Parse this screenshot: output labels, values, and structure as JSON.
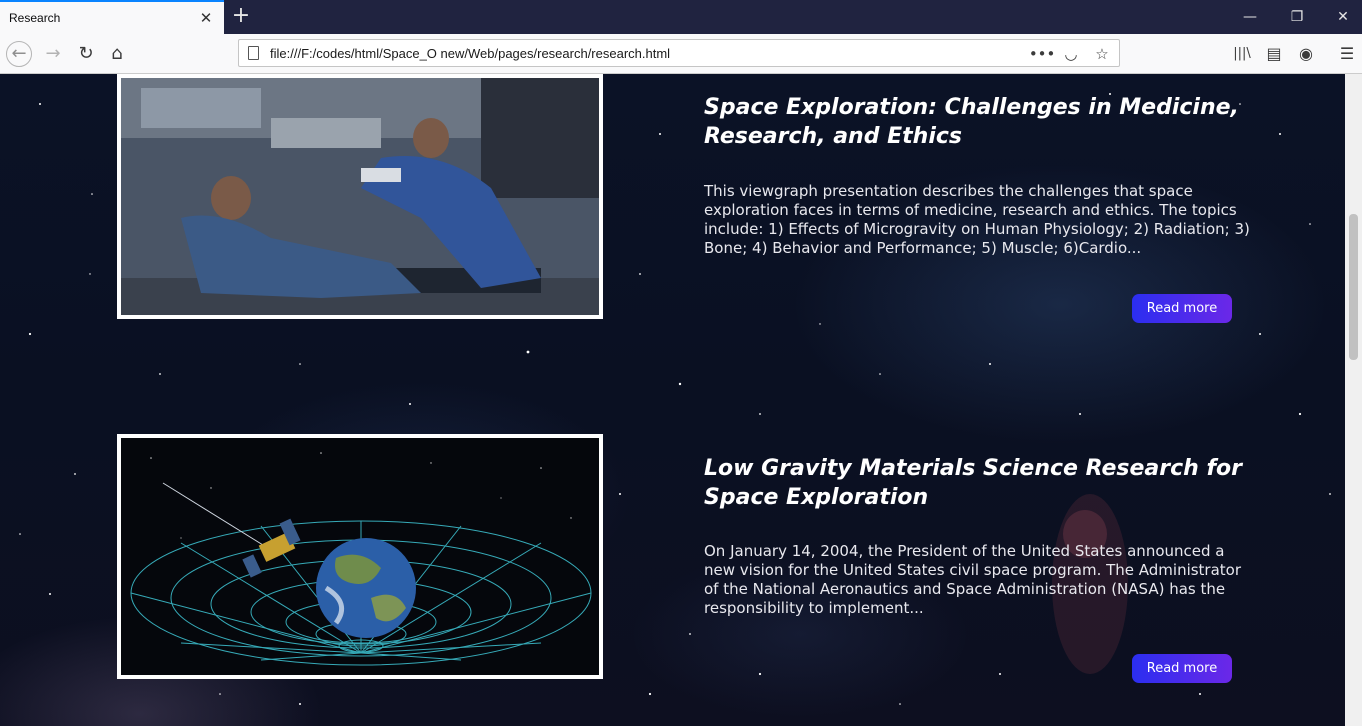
{
  "browser": {
    "tab_title": "Research",
    "url": "file:///F:/codes/html/Space_O new/Web/pages/research/research.html",
    "tab_close_glyph": "✕",
    "new_tab_glyph": "+",
    "icons": {
      "back": "←",
      "forward": "→",
      "reload": "↻",
      "home": "⌂",
      "page_actions": "•••",
      "pocket": "◡",
      "bookmark": "☆",
      "library": "|||\\",
      "sidebar": "▤",
      "account": "◉",
      "menu": "☰",
      "minimize": "—",
      "restore": "❐",
      "close": "✕"
    }
  },
  "articles": [
    {
      "title": "Space Exploration: Challenges in Medicine, Research, and Ethics",
      "description": "This viewgraph presentation describes the challenges that space exploration faces in terms of medicine, research and ethics. The topics include: 1) Effects of Microgravity on Human Physiology; 2) Radiation; 3) Bone; 4) Behavior and Performance; 5) Muscle; 6)Cardio...",
      "button": "Read more"
    },
    {
      "title": "Low Gravity Materials Science Research for Space Exploration",
      "description": "On January 14, 2004, the President of the United States announced a new vision for the United States civil space program. The Administrator of the National Aeronautics and Space Administration (NASA) has the responsibility to implement...",
      "button": "Read more"
    }
  ]
}
